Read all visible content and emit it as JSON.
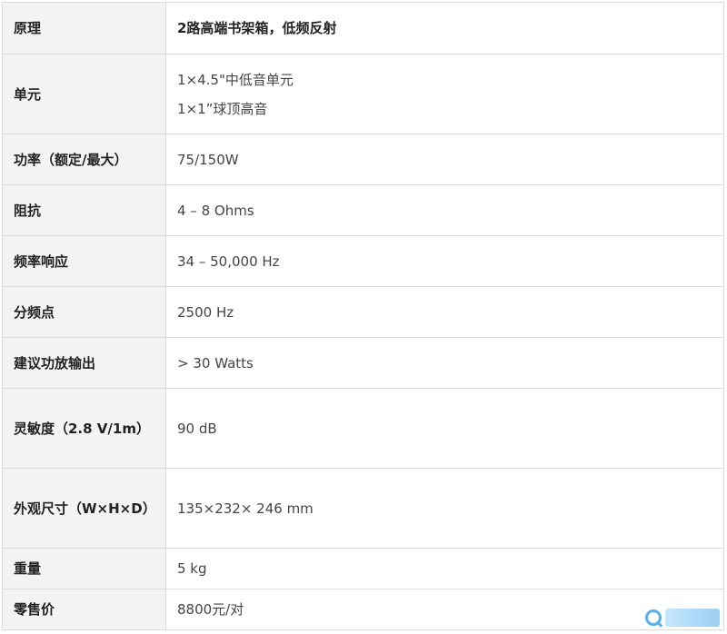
{
  "rows": [
    {
      "label": "原理",
      "value": "2路高端书架箱，低频反射"
    },
    {
      "label": "单元",
      "lines": [
        "1×4.5\"中低音单元",
        "1×1”球顶高音"
      ]
    },
    {
      "label": "功率（额定/最大）",
      "value": "75/150W"
    },
    {
      "label": "阻抗",
      "value": "4 – 8 Ohms"
    },
    {
      "label": "频率响应",
      "value": "34 – 50,000 Hz"
    },
    {
      "label": "分频点",
      "value": "2500 Hz"
    },
    {
      "label": "建议功放输出",
      "value": "> 30 Watts"
    },
    {
      "label": "灵敏度（2.8 V/1m）",
      "value": "90 dB"
    },
    {
      "label": "外观尺寸（W×H×D）",
      "value": "135×232× 246 mm"
    },
    {
      "label": "重量",
      "value": "5 kg"
    },
    {
      "label": "零售价",
      "value": "8800元/对"
    }
  ],
  "colors": {
    "label_bg": "#f3f3f3",
    "border": "#dcdcdc",
    "watermark": "#3aa0e8"
  },
  "watermark_icon": "magnifier-logo-icon"
}
